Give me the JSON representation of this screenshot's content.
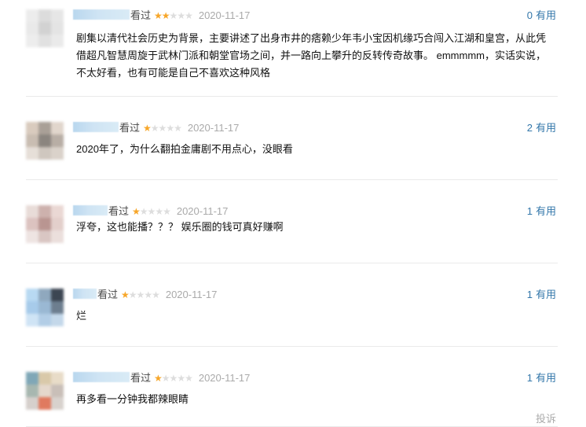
{
  "reviews": [
    {
      "status": "看过",
      "rating": 2,
      "date": "2020-11-17",
      "useful_count": "0",
      "useful_label": "有用",
      "content": "剧集以清代社会历史为背景，主要讲述了出身市井的痞赖少年韦小宝因机缘巧合闯入江湖和皇宫，从此凭借超凡智慧周旋于武林门派和朝堂官场之间，并一路向上攀升的反转传奇故事。 emmmmm，实话实说，不太好看，也有可能是自己不喜欢这种风格",
      "avatar_colors": [
        "#ececec",
        "#dcdcdc",
        "#e6e6e6",
        "#e9e9e9",
        "#d2d2d2",
        "#e4e4e4",
        "#ededed",
        "#e1e1e1",
        "#eaeaea"
      ]
    },
    {
      "status": "看过",
      "rating": 1,
      "date": "2020-11-17",
      "useful_count": "2",
      "useful_label": "有用",
      "content": "2020年了，为什么翻拍金庸剧不用点心，没眼看",
      "avatar_colors": [
        "#d9cbbe",
        "#a9a097",
        "#e1d6cc",
        "#c9bdb2",
        "#8b857f",
        "#b8aea5",
        "#e6dfd8",
        "#cfc7bf",
        "#dad2ca"
      ]
    },
    {
      "status": "看过",
      "rating": 1,
      "date": "2020-11-17",
      "useful_count": "1",
      "useful_label": "有用",
      "content": "浮夸，这也能播？？？ 娱乐圈的钱可真好赚啊",
      "avatar_colors": [
        "#e8dcd8",
        "#cdb1ad",
        "#ead8d4",
        "#dcc3c0",
        "#b99591",
        "#e3cfcb",
        "#eee4e2",
        "#d9c6c3",
        "#ebdfdc"
      ]
    },
    {
      "status": "看过",
      "rating": 1,
      "date": "2020-11-17",
      "useful_count": "1",
      "useful_label": "有用",
      "content": "烂",
      "avatar_colors": [
        "#b8d9f2",
        "#8fa8be",
        "#3c4652",
        "#a7cbea",
        "#9ab8d3",
        "#6d7e8f",
        "#cfe4f5",
        "#b2cde6",
        "#c4d8ea"
      ]
    },
    {
      "status": "看过",
      "rating": 1,
      "date": "2020-11-17",
      "useful_count": "1",
      "useful_label": "有用",
      "content": "再多看一分钟我都辣眼睛",
      "avatar_colors": [
        "#7fa7b7",
        "#d9c9a9",
        "#e8dcc8",
        "#a7b7b0",
        "#e5d8cc",
        "#c9bfb8",
        "#d6d0cc",
        "#e07a5f",
        "#d8d2cd"
      ]
    }
  ],
  "report_label": "投诉"
}
